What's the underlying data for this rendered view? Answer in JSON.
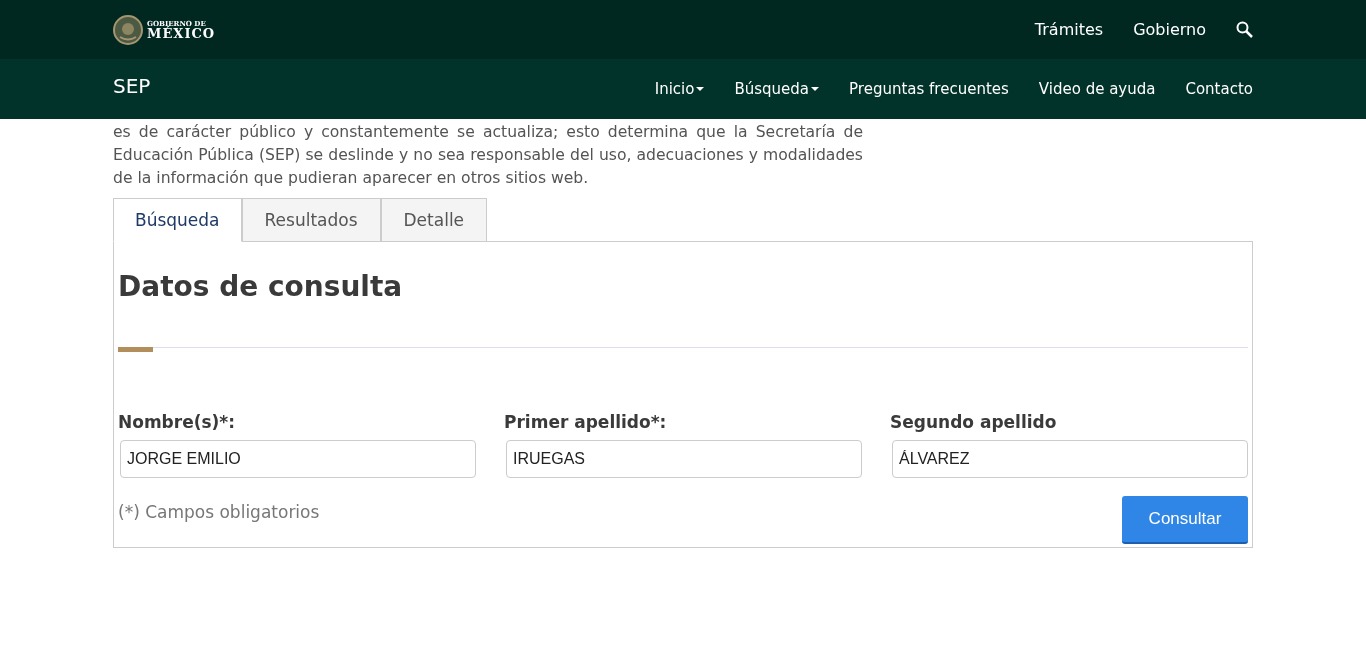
{
  "top_bar": {
    "logo": {
      "line1": "GOBIERNO DE",
      "line2": "MÉXICO"
    },
    "links": [
      "Trámites",
      "Gobierno"
    ]
  },
  "nav_bar": {
    "brand": "SEP",
    "items": [
      {
        "label": "Inicio",
        "dropdown": true
      },
      {
        "label": "Búsqueda",
        "dropdown": true
      },
      {
        "label": "Preguntas frecuentes",
        "dropdown": false
      },
      {
        "label": "Video de ayuda",
        "dropdown": false
      },
      {
        "label": "Contacto",
        "dropdown": false
      }
    ]
  },
  "intro": "es de carácter público y constantemente se actualiza; esto determina que la Secretaría de Educación Pública (SEP) se deslinde y no sea responsable del uso, adecuaciones y modalidades de la información que pudieran aparecer en otros sitios web.",
  "tabs": [
    {
      "label": "Búsqueda",
      "selected": true
    },
    {
      "label": "Resultados",
      "selected": false
    },
    {
      "label": "Detalle",
      "selected": false
    }
  ],
  "form": {
    "title": "Datos de consulta",
    "fields": [
      {
        "label": "Nombre(s)*:",
        "value": "JORGE EMILIO"
      },
      {
        "label": "Primer apellido*:",
        "value": "IRUEGAS"
      },
      {
        "label": "Segundo apellido",
        "value": "ÁLVAREZ"
      }
    ],
    "note": "(*) Campos obligatorios",
    "button": "Consultar"
  }
}
